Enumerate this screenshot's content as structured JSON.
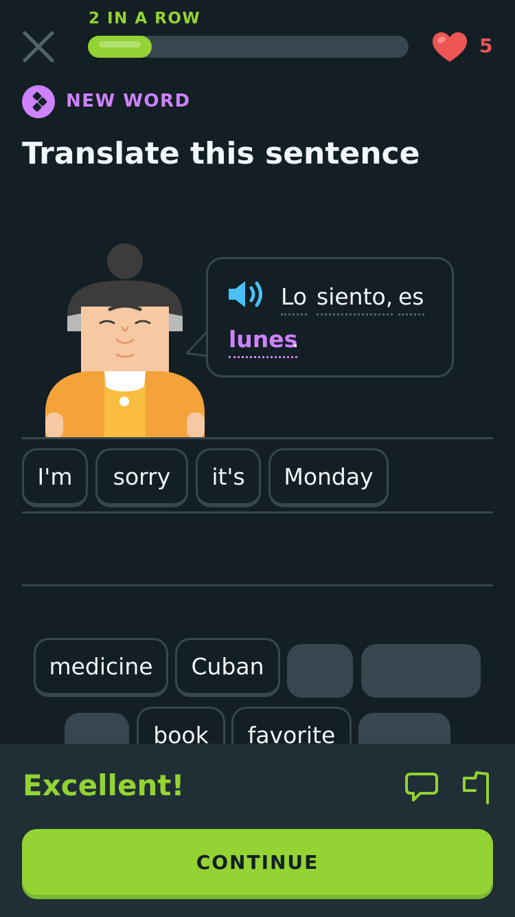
{
  "header": {
    "streak_label": "2 IN A ROW",
    "progress": 0.2,
    "hearts": "5"
  },
  "challenge": {
    "badge": "NEW WORD",
    "title": "Translate this sentence"
  },
  "prompt": {
    "words": [
      "Lo",
      "siento,",
      "es",
      "lunes",
      "."
    ]
  },
  "answer": {
    "selected_tiles": [
      "I'm",
      "sorry",
      "it's",
      "Monday"
    ]
  },
  "word_bank": {
    "row1": [
      "medicine",
      "Cuban"
    ],
    "row2": [
      "book",
      "favorite"
    ]
  },
  "feedback": {
    "title": "Excellent!",
    "continue_label": "CONTINUE"
  },
  "colors": {
    "background": "#131f24",
    "accent_green": "#93d333",
    "new_word_purple": "#ce82ff",
    "heart_red": "#ee5555",
    "speaker_blue": "#49c0f8"
  }
}
